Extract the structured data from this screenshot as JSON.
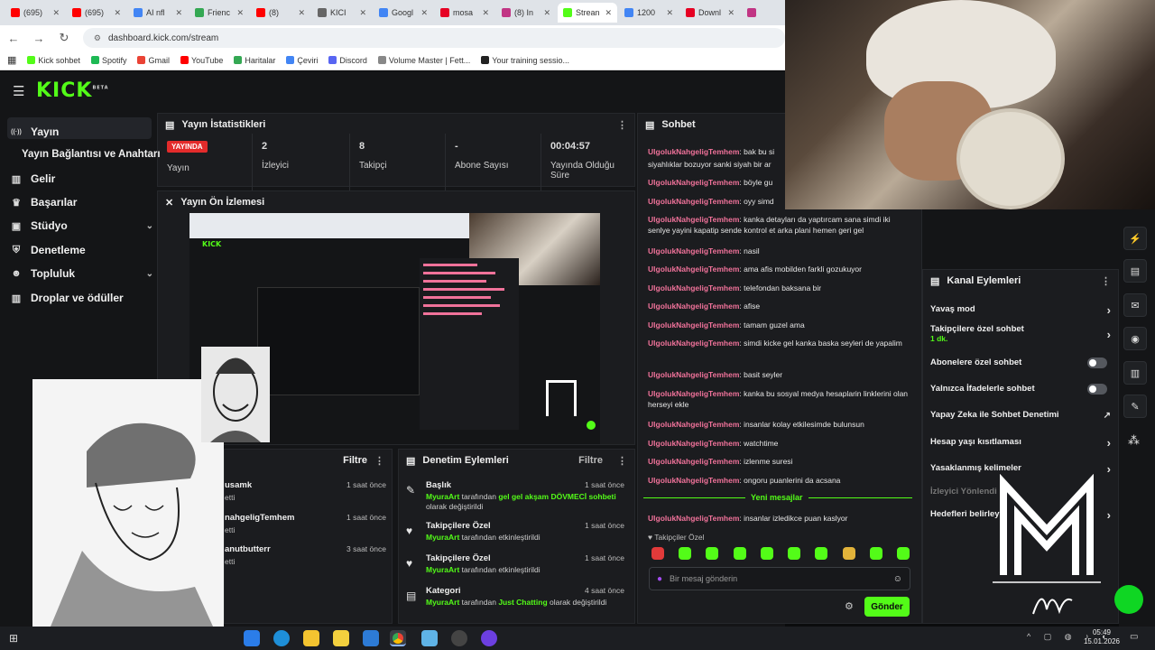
{
  "browser": {
    "tabs": [
      {
        "label": "(695)",
        "color": "#ff0000"
      },
      {
        "label": "(695)",
        "color": "#ff0000"
      },
      {
        "label": "AI nfl",
        "color": "#4285f4"
      },
      {
        "label": "Frienc",
        "color": "#34a853"
      },
      {
        "label": "(8)",
        "color": "#ff0000"
      },
      {
        "label": "KICI",
        "color": "#666666"
      },
      {
        "label": "Googl",
        "color": "#4285f4"
      },
      {
        "label": "mosa",
        "color": "#e60023"
      },
      {
        "label": "(8) In",
        "color": "#c13584"
      },
      {
        "label": "Strean",
        "color": "#53fc18",
        "active": true
      },
      {
        "label": "1200",
        "color": "#4285f4"
      },
      {
        "label": "Downl",
        "color": "#e60023"
      },
      {
        "label": "",
        "color": "#c13584"
      }
    ],
    "url": "dashboard.kick.com/stream",
    "bookmarks": [
      {
        "label": "Kick sohbet",
        "color": "#53fc18"
      },
      {
        "label": "Spotify",
        "color": "#1db954"
      },
      {
        "label": "Gmail",
        "color": "#ea4335"
      },
      {
        "label": "YouTube",
        "color": "#ff0000"
      },
      {
        "label": "Haritalar",
        "color": "#34a853"
      },
      {
        "label": "Çeviri",
        "color": "#4285f4"
      },
      {
        "label": "Discord",
        "color": "#5865f2"
      },
      {
        "label": "Volume Master | Fett...",
        "color": "#888888"
      },
      {
        "label": "Your training sessio...",
        "color": "#222222"
      }
    ]
  },
  "kick": {
    "logo": "KICK",
    "logo_badge": "BETA",
    "sidebar": [
      {
        "label": "Yayın",
        "icon": "broadcast-icon"
      },
      {
        "label": "Yayın Bağlantısı ve Anahtarı",
        "icon": ""
      },
      {
        "label": "Gelir",
        "icon": "chart-icon"
      },
      {
        "label": "Başarılar",
        "icon": "trophy-icon"
      },
      {
        "label": "Stüdyo",
        "icon": "studio-icon",
        "chevron": true
      },
      {
        "label": "Denetleme",
        "icon": "shield-icon"
      },
      {
        "label": "Topluluk",
        "icon": "people-icon",
        "chevron": true
      },
      {
        "label": "Droplar ve ödüller",
        "icon": "gift-icon"
      }
    ],
    "stats": {
      "title": "Yayın İstatistikleri",
      "live_badge": "YAYINDA",
      "items": [
        {
          "label": "Yayın",
          "value": ""
        },
        {
          "label": "İzleyici",
          "value": "2"
        },
        {
          "label": "Takipçi",
          "value": "8"
        },
        {
          "label": "Abone Sayısı",
          "value": "-"
        },
        {
          "label": "Yayında Olduğu Süre",
          "value": "00:04:57"
        }
      ]
    },
    "preview": {
      "title": "Yayın Ön İzlemesi"
    },
    "activity": {
      "filter": "Filtre",
      "rows": [
        {
          "name": "usamk",
          "sub": "etti",
          "time": "1 saat önce"
        },
        {
          "name": "nahgeligTemhem",
          "sub": "etti",
          "time": "1 saat önce"
        },
        {
          "name": "anutbutterr",
          "sub": "etti",
          "time": "3 saat önce"
        }
      ]
    },
    "moderation": {
      "title": "Denetim Eylemleri",
      "filter": "Filtre",
      "rows": [
        {
          "title": "Başlık",
          "actor": "MyuraArt",
          "text1": " tarafından ",
          "highlight": "gel gel akşam DÖVMECİ sohbeti",
          "text2": " olarak değiştirildi",
          "time": "1 saat önce",
          "icon": "pencil-icon"
        },
        {
          "title": "Takipçilere Özel",
          "actor": "MyuraArt",
          "text1": " tarafından etkinleştirildi",
          "highlight": "",
          "text2": "",
          "time": "1 saat önce",
          "icon": "heart-icon"
        },
        {
          "title": "Takipçilere Özel",
          "actor": "MyuraArt",
          "text1": " tarafından etkinleştirildi",
          "highlight": "",
          "text2": "",
          "time": "1 saat önce",
          "icon": "heart-icon"
        },
        {
          "title": "Kategori",
          "actor": "MyuraArt",
          "text1": " tarafından ",
          "highlight": "Just Chatting",
          "text2": " olarak değiştirildi",
          "time": "4 saat önce",
          "icon": "category-icon"
        }
      ]
    },
    "chat": {
      "title": "Sohbet",
      "username": "UlgolukNahgeligTemhem",
      "messages": [
        "bak bu si",
        "siyahlıklar bozuyor sanki siyah bir ar",
        "böyle gu",
        "oyy simd",
        "kanka detayları da yaptırcam sana simdi iki senlye yayini kapatip sende kontrol et arka plani hemen geri gel",
        "nasil",
        "ama afis mobilden farkli gozukuyor",
        "telefondan baksana bir",
        "afise",
        "tamam guzel ama",
        "simdi kicke gel kanka baska seyleri de yapalim",
        "basit seyler",
        "kanka bu sosyal medya hesaplarin linklerini olan herseyi ekle",
        "insanlar kolay etkilesimde bulunsun",
        "watchtime",
        "izlenme suresi",
        "ongoru puanlerini da acsana",
        "insanlar izledikce puan kaslyor"
      ],
      "new_messages": "Yeni mesajlar",
      "followers_only": "Takipçiler Özel",
      "placeholder": "Bir mesaj gönderin",
      "send": "Gönder"
    },
    "channel_actions": {
      "title": "Kanal Eylemleri",
      "rows": [
        {
          "label": "Yavaş mod",
          "control": "arrow"
        },
        {
          "label": "Takipçilere özel sohbet",
          "sub": "1 dk.",
          "control": "arrow"
        },
        {
          "label": "Abonelere özel sohbet",
          "control": "toggle"
        },
        {
          "label": "Yalnızca İfadelerle sohbet",
          "control": "toggle"
        },
        {
          "label": "Yapay Zeka ile Sohbet Denetimi",
          "control": "external"
        },
        {
          "label": "Hesap yaşı kısıtlaması",
          "control": "arrow"
        },
        {
          "label": "Yasaklanmış kelimeler",
          "control": "arrow"
        },
        {
          "label": "İzleyici Yönlendi",
          "control": "none"
        },
        {
          "label": "Hedefleri belirley",
          "control": "arrow"
        }
      ]
    }
  },
  "taskbar": {
    "time": "05:49",
    "date": "15.01.2026"
  },
  "colors": {
    "brand": "#53fc18",
    "username": "#f0729a",
    "live": "#e32b2b"
  }
}
